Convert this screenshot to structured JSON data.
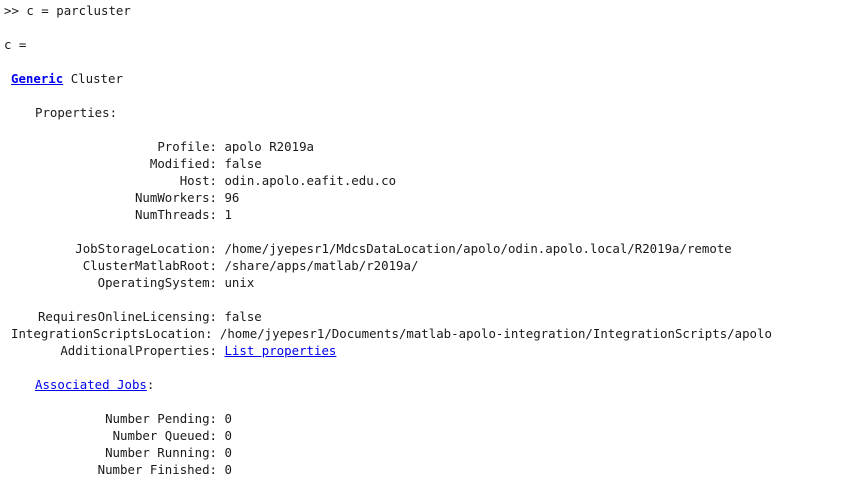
{
  "prompt": ">>",
  "command": "c = parcluster",
  "echo": "c =",
  "object": {
    "type_link": "Generic",
    "type_suffix": "Cluster"
  },
  "section_properties": "Properties:",
  "props": {
    "profile": {
      "label": "Profile:",
      "value": "apolo R2019a"
    },
    "modified": {
      "label": "Modified:",
      "value": "false"
    },
    "host": {
      "label": "Host:",
      "value": "odin.apolo.eafit.edu.co"
    },
    "numworkers": {
      "label": "NumWorkers:",
      "value": "96"
    },
    "numthreads": {
      "label": "NumThreads:",
      "value": "1"
    },
    "jobstorage": {
      "label": "JobStorageLocation:",
      "value": "/home/jyepesr1/MdcsDataLocation/apolo/odin.apolo.local/R2019a/remote"
    },
    "matlabroot": {
      "label": "ClusterMatlabRoot:",
      "value": "/share/apps/matlab/r2019a/"
    },
    "os": {
      "label": "OperatingSystem:",
      "value": "unix"
    },
    "licensing": {
      "label": "RequiresOnlineLicensing:",
      "value": "false"
    },
    "scripts": {
      "label": "IntegrationScriptsLocation:",
      "value": "/home/jyepesr1/Documents/matlab-apolo-integration/IntegrationScripts/apolo"
    },
    "additional": {
      "label": "AdditionalProperties:",
      "link": "List properties"
    }
  },
  "jobs": {
    "link": "Associated Jobs",
    "suffix": ":",
    "pending": {
      "label": "Number Pending:",
      "value": "0"
    },
    "queued": {
      "label": "Number Queued:",
      "value": "0"
    },
    "running": {
      "label": "Number Running:",
      "value": "0"
    },
    "finished": {
      "label": "Number Finished:",
      "value": "0"
    }
  }
}
